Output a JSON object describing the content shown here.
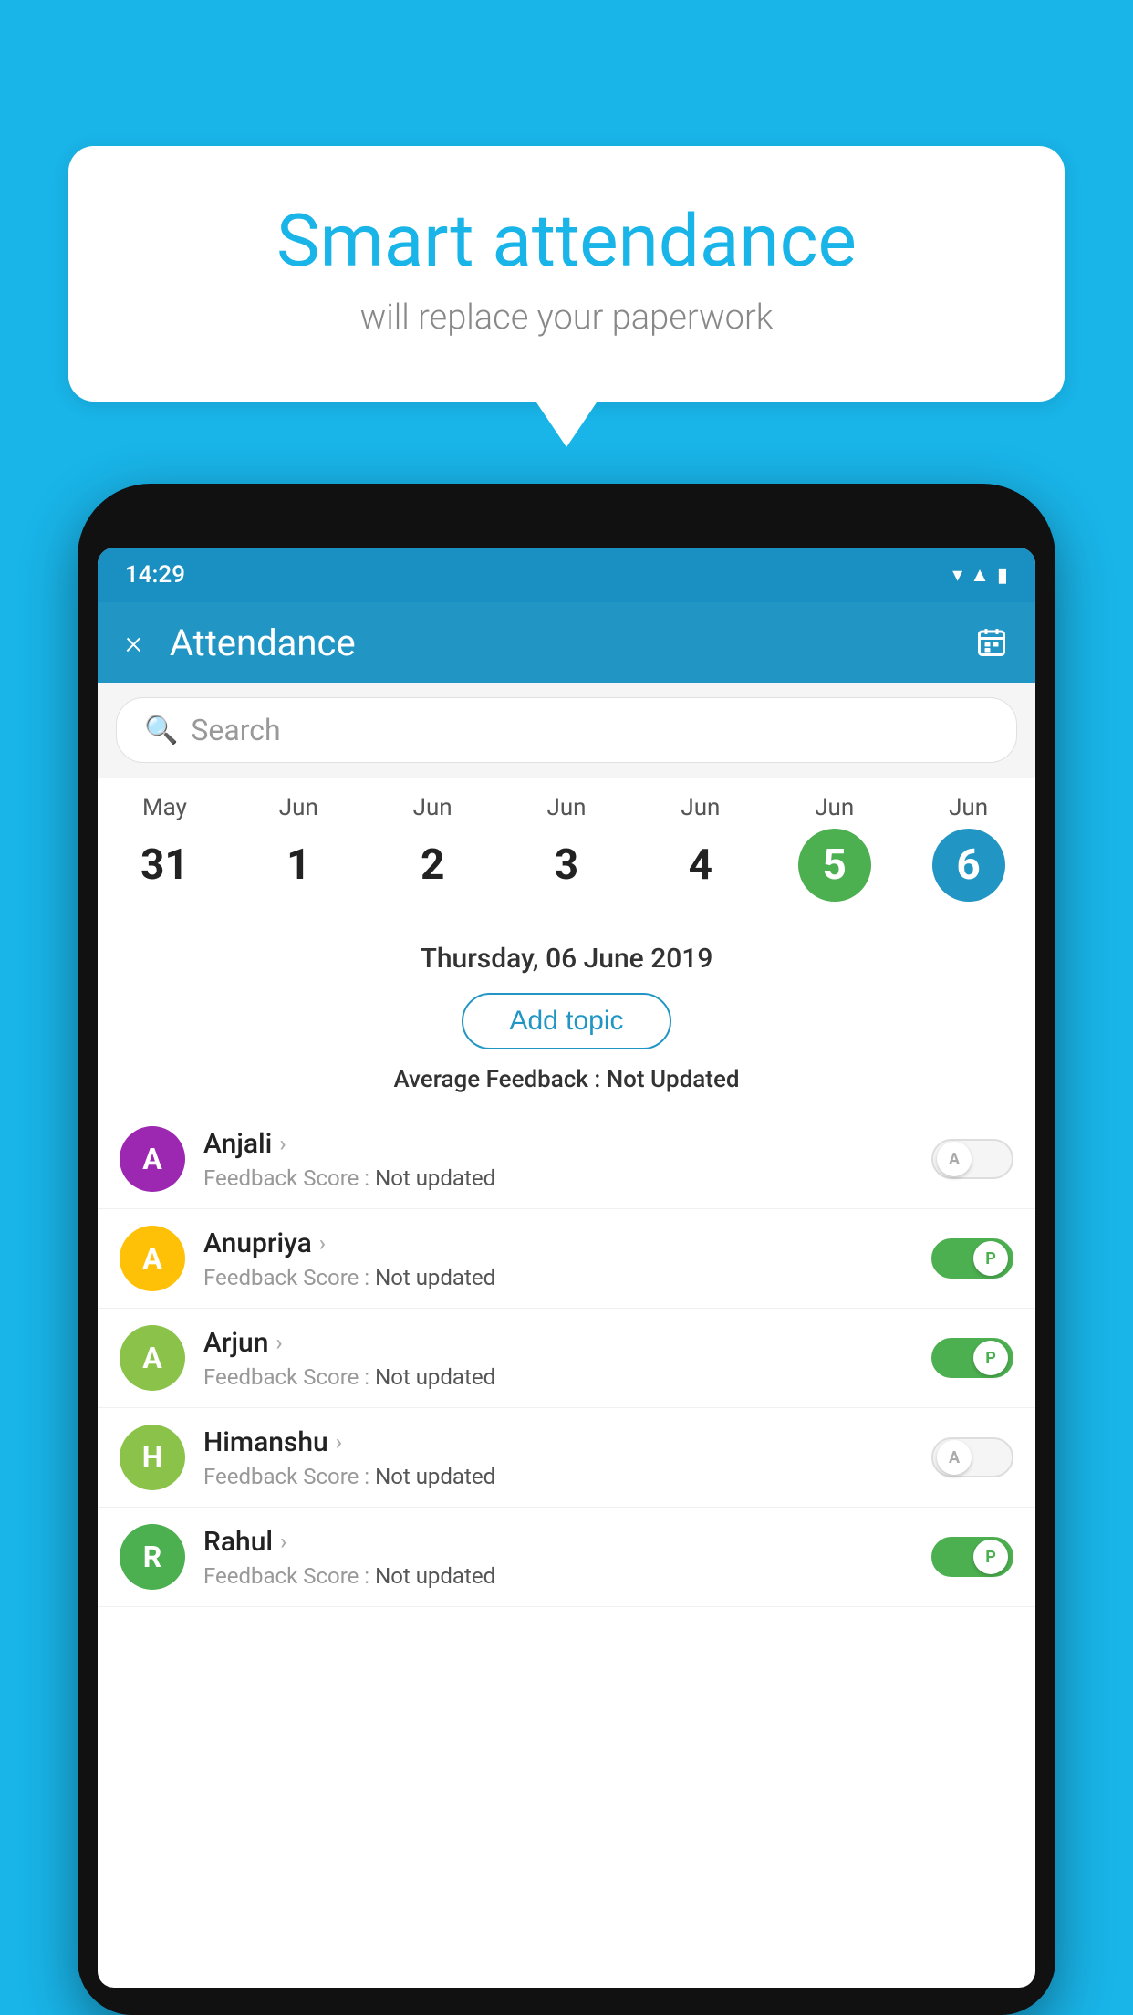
{
  "background_color": "#19b4e8",
  "bubble": {
    "title": "Smart attendance",
    "subtitle": "will replace your paperwork"
  },
  "status_bar": {
    "time": "14:29",
    "icons": [
      "wifi",
      "signal",
      "battery"
    ]
  },
  "app_bar": {
    "title": "Attendance",
    "close_label": "×",
    "calendar_label": "📅"
  },
  "search": {
    "placeholder": "Search"
  },
  "date_columns": [
    {
      "month": "May",
      "day": "31",
      "state": "normal"
    },
    {
      "month": "Jun",
      "day": "1",
      "state": "normal"
    },
    {
      "month": "Jun",
      "day": "2",
      "state": "normal"
    },
    {
      "month": "Jun",
      "day": "3",
      "state": "normal"
    },
    {
      "month": "Jun",
      "day": "4",
      "state": "normal"
    },
    {
      "month": "Jun",
      "day": "5",
      "state": "today"
    },
    {
      "month": "Jun",
      "day": "6",
      "state": "selected"
    }
  ],
  "selected_date": "Thursday, 06 June 2019",
  "add_topic_label": "Add topic",
  "avg_feedback_label": "Average Feedback :",
  "avg_feedback_value": "Not Updated",
  "students": [
    {
      "name": "Anjali",
      "initial": "A",
      "avatar_color": "#9c27b0",
      "feedback_label": "Feedback Score :",
      "feedback_value": "Not updated",
      "attendance": "absent",
      "toggle_label": "A"
    },
    {
      "name": "Anupriya",
      "initial": "A",
      "avatar_color": "#ffc107",
      "feedback_label": "Feedback Score :",
      "feedback_value": "Not updated",
      "attendance": "present",
      "toggle_label": "P"
    },
    {
      "name": "Arjun",
      "initial": "A",
      "avatar_color": "#8bc34a",
      "feedback_label": "Feedback Score :",
      "feedback_value": "Not updated",
      "attendance": "present",
      "toggle_label": "P"
    },
    {
      "name": "Himanshu",
      "initial": "H",
      "avatar_color": "#8bc34a",
      "feedback_label": "Feedback Score :",
      "feedback_value": "Not updated",
      "attendance": "absent",
      "toggle_label": "A"
    },
    {
      "name": "Rahul",
      "initial": "R",
      "avatar_color": "#4caf50",
      "feedback_label": "Feedback Score :",
      "feedback_value": "Not updated",
      "attendance": "present",
      "toggle_label": "P"
    }
  ]
}
